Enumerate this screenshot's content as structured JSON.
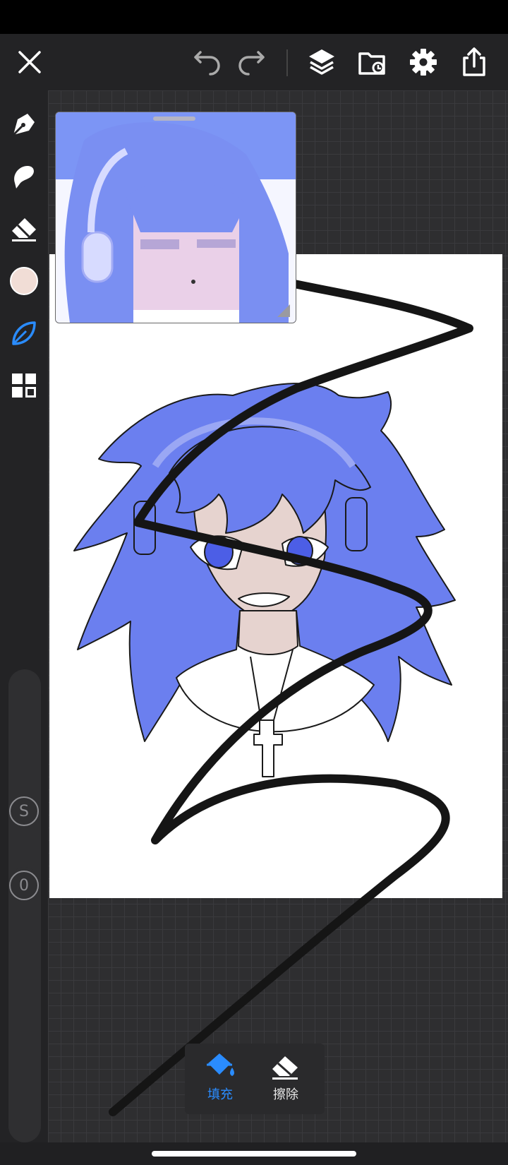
{
  "toolbar": {
    "icons": [
      "close-icon",
      "undo-icon",
      "redo-icon",
      "layers-icon",
      "import-icon",
      "settings-icon",
      "share-icon"
    ]
  },
  "sidebar": {
    "tools": [
      "pen-icon",
      "smudge-icon",
      "eraser-icon",
      "color-swatch",
      "brush-icon",
      "grid-icon"
    ],
    "current_color": "#f1ddd6",
    "accent": "#2a8cff",
    "size_slider_label": "S",
    "opacity_slider_label": "0"
  },
  "bottom_panel": {
    "fill_label": "填充",
    "erase_label": "擦除",
    "active_color": "#2a8cff"
  }
}
